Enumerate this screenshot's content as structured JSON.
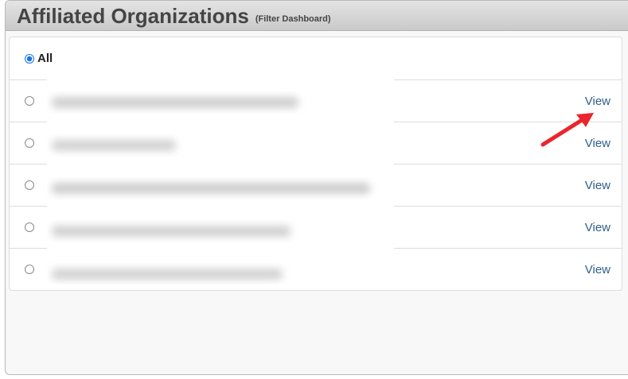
{
  "panel": {
    "title": "Affiliated Organizations",
    "subtitle": "(Filter Dashboard)"
  },
  "filter": {
    "all_label": "All",
    "selected": "All"
  },
  "organizations": [
    {
      "name": "",
      "view_label": "View"
    },
    {
      "name": "",
      "view_label": "View"
    },
    {
      "name": "",
      "view_label": "View"
    },
    {
      "name": "",
      "view_label": "View"
    },
    {
      "name": "",
      "view_label": "View"
    }
  ],
  "annotation": {
    "arrow_color": "#e8262c",
    "points_to": "first view link"
  }
}
